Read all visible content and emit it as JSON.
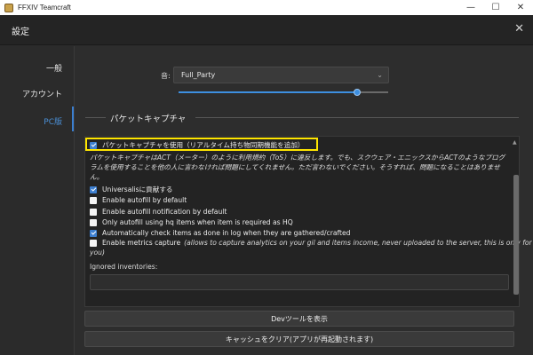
{
  "window": {
    "title": "FFXIV Teamcraft",
    "controls": [
      "—",
      "☐",
      "✕"
    ]
  },
  "dialog": {
    "title": "設定",
    "close_glyph": "✕"
  },
  "sidebar": {
    "items": [
      {
        "label": "一般"
      },
      {
        "label": "アカウント"
      },
      {
        "label": "PC版"
      }
    ],
    "active": "PC版"
  },
  "sound": {
    "label": "音:",
    "selected": "Full_Party",
    "volume": 0.85
  },
  "section": {
    "title": "パケットキャプチャ"
  },
  "packet_capture": {
    "label": "パケットキャプチャを使用（リアルタイム持ち物同期機能を追加）",
    "checked": true,
    "description": "パケットキャプチャはACT（メーター）のように利用規約（ToS）に違反します。でも、スクウェア・エニックスからACTのようなプログラムを使用することを他の人に言わなければ問題にしてくれません。ただ言わないでください。そうすれば、問題になることはありません。"
  },
  "options": [
    {
      "label": "Universalisに貢献する",
      "checked": true
    },
    {
      "label": "Enable autofill by default",
      "checked": false
    },
    {
      "label": "Enable autofill notification by default",
      "checked": false
    },
    {
      "label": "Only autofill using hq items when item is required as HQ",
      "checked": false
    },
    {
      "label": "Automatically check items as done in log when they are gathered/crafted",
      "checked": true
    },
    {
      "label": "Enable metrics capture",
      "checked": false,
      "note": "(allows to capture analytics on your gil and items income, never uploaded to the server, this is only for"
    }
  ],
  "metrics_note_tail": "you)",
  "ignored_inventories": {
    "label": "Ignored inventories:",
    "value": ""
  },
  "buttons": {
    "devtools": "Devツールを表示",
    "clear_cache": "キャッシュをクリア(アプリが再起動されます)"
  },
  "colors": {
    "accent": "#3d7fd0",
    "highlight": "#ffe600",
    "background": "#2b2b2b"
  }
}
